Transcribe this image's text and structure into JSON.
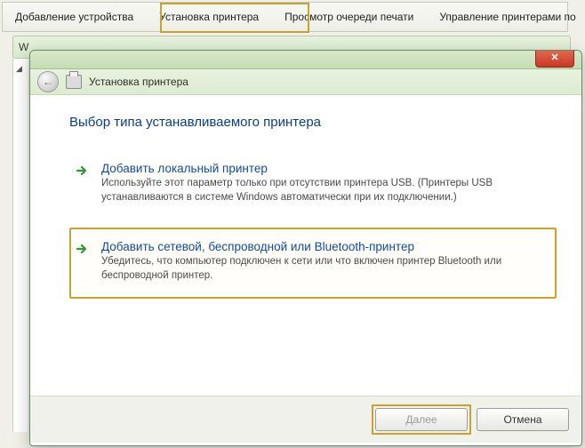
{
  "toolbar": {
    "items": [
      "Добавление устройства",
      "Установка принтера",
      "Просмотр очереди печати",
      "Управление принтерами по"
    ],
    "highlighted_index": 1
  },
  "background": {
    "addressbar_prefix": "W"
  },
  "wizard": {
    "header_title": "Установка принтера",
    "close_glyph": "✕",
    "back_glyph": "←",
    "page_title": "Выбор типа устанавливаемого принтера",
    "options": [
      {
        "title": "Добавить локальный принтер",
        "desc": "Используйте этот параметр только при отсутствии принтера USB. (Принтеры USB устанавливаются в системе Windows автоматически при их подключении.)",
        "selected": false
      },
      {
        "title": "Добавить сетевой, беспроводной или Bluetooth-принтер",
        "desc": "Убедитесь, что компьютер подключен к сети или что включен принтер Bluetooth или беспроводной принтер.",
        "selected": true
      }
    ],
    "buttons": {
      "next": "Далее",
      "cancel": "Отмена"
    }
  }
}
